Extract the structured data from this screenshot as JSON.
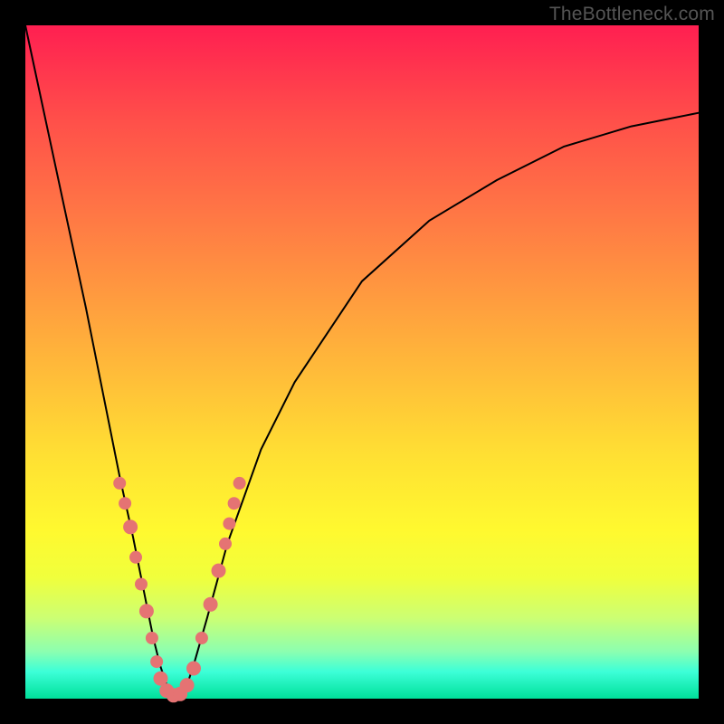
{
  "watermark": {
    "text": "TheBottleneck.com"
  },
  "frame": {
    "border_color": "#000000",
    "border_px": 28
  },
  "gradient": {
    "stops": [
      {
        "pos": 0.0,
        "color": "#ff1f51"
      },
      {
        "pos": 0.14,
        "color": "#ff4f4a"
      },
      {
        "pos": 0.28,
        "color": "#ff7745"
      },
      {
        "pos": 0.4,
        "color": "#ff9a3f"
      },
      {
        "pos": 0.52,
        "color": "#ffbd39"
      },
      {
        "pos": 0.64,
        "color": "#ffe033"
      },
      {
        "pos": 0.75,
        "color": "#fff92f"
      },
      {
        "pos": 0.82,
        "color": "#f0ff3c"
      },
      {
        "pos": 0.88,
        "color": "#ccff73"
      },
      {
        "pos": 0.93,
        "color": "#8cffb0"
      },
      {
        "pos": 0.96,
        "color": "#3cffd8"
      },
      {
        "pos": 1.0,
        "color": "#00e09a"
      }
    ]
  },
  "chart_data": {
    "type": "line",
    "title": "",
    "xlabel": "",
    "ylabel": "",
    "xlim": [
      0,
      1
    ],
    "ylim": [
      0,
      1
    ],
    "note": "Vertical axis is bottleneck % (100% at top/red → 0% at bottom/green). Horizontal axis is relative component strength. Curve minimum ≈ 0% bottleneck near x≈0.22.",
    "series": [
      {
        "name": "bottleneck-curve",
        "x": [
          0.0,
          0.03,
          0.06,
          0.09,
          0.12,
          0.14,
          0.16,
          0.18,
          0.19,
          0.2,
          0.21,
          0.22,
          0.23,
          0.24,
          0.25,
          0.27,
          0.3,
          0.35,
          0.4,
          0.5,
          0.6,
          0.7,
          0.8,
          0.9,
          1.0
        ],
        "values": [
          1.0,
          0.86,
          0.72,
          0.58,
          0.43,
          0.33,
          0.24,
          0.14,
          0.09,
          0.05,
          0.02,
          0.0,
          0.0,
          0.02,
          0.05,
          0.12,
          0.23,
          0.37,
          0.47,
          0.62,
          0.71,
          0.77,
          0.82,
          0.85,
          0.87
        ]
      }
    ],
    "beads": {
      "note": "Pink bead markers overlaid on curve near the trough region; coordinates in plot-area fraction (0–1, y measured from top).",
      "points": [
        {
          "x": 0.14,
          "y": 0.68,
          "r": 7
        },
        {
          "x": 0.148,
          "y": 0.71,
          "r": 7
        },
        {
          "x": 0.156,
          "y": 0.745,
          "r": 8
        },
        {
          "x": 0.164,
          "y": 0.79,
          "r": 7
        },
        {
          "x": 0.172,
          "y": 0.83,
          "r": 7
        },
        {
          "x": 0.18,
          "y": 0.87,
          "r": 8
        },
        {
          "x": 0.188,
          "y": 0.91,
          "r": 7
        },
        {
          "x": 0.195,
          "y": 0.945,
          "r": 7
        },
        {
          "x": 0.201,
          "y": 0.97,
          "r": 8
        },
        {
          "x": 0.21,
          "y": 0.988,
          "r": 8
        },
        {
          "x": 0.22,
          "y": 0.995,
          "r": 8
        },
        {
          "x": 0.23,
          "y": 0.993,
          "r": 8
        },
        {
          "x": 0.24,
          "y": 0.98,
          "r": 8
        },
        {
          "x": 0.25,
          "y": 0.955,
          "r": 8
        },
        {
          "x": 0.262,
          "y": 0.91,
          "r": 7
        },
        {
          "x": 0.275,
          "y": 0.86,
          "r": 8
        },
        {
          "x": 0.287,
          "y": 0.81,
          "r": 8
        },
        {
          "x": 0.297,
          "y": 0.77,
          "r": 7
        },
        {
          "x": 0.303,
          "y": 0.74,
          "r": 7
        },
        {
          "x": 0.31,
          "y": 0.71,
          "r": 7
        },
        {
          "x": 0.318,
          "y": 0.68,
          "r": 7
        }
      ]
    }
  }
}
